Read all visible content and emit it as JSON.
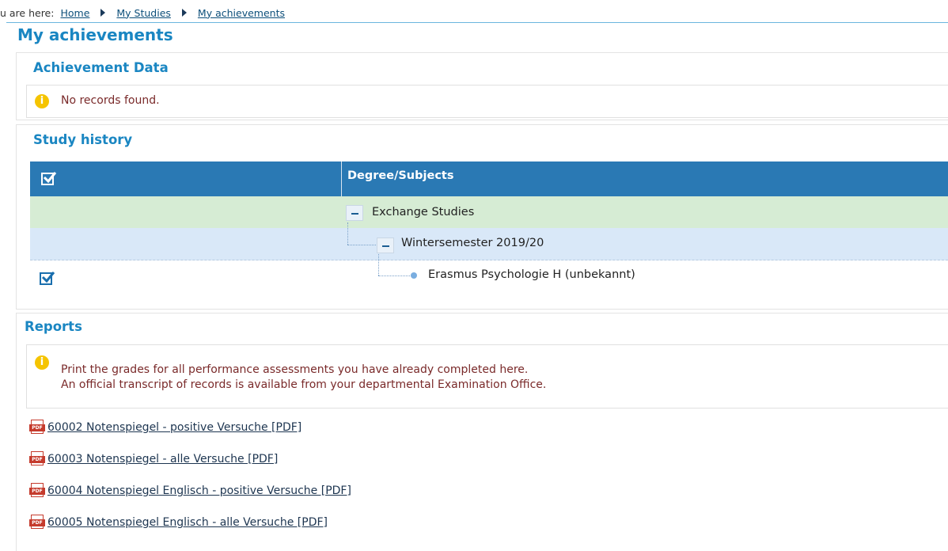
{
  "breadcrumb": {
    "prefix": "u are here:",
    "items": [
      "Home",
      "My Studies",
      "My achievements"
    ]
  },
  "page": {
    "title": "My achievements"
  },
  "achievement_data": {
    "title": "Achievement Data",
    "message": "No records found."
  },
  "study_history": {
    "title": "Study history",
    "column_header": "Degree/Subjects",
    "rows": [
      {
        "label": "Exchange Studies",
        "level": 0
      },
      {
        "label": "Wintersemester 2019/20",
        "level": 1
      },
      {
        "label": "Erasmus Psychologie H (unbekannt)",
        "level": 2,
        "checked": true
      }
    ]
  },
  "reports": {
    "title": "Reports",
    "info_line1": "Print the grades for all performance assessments you have already completed here.",
    "info_line2": "An official transcript of records is available from your departmental Examination Office.",
    "pdf_icon_text": "PDF",
    "links": [
      "60002 Notenspiegel - positive Versuche [PDF]",
      "60003 Notenspiegel - alle Versuche [PDF]",
      "60004 Notenspiegel Englisch - positive Versuche [PDF]",
      "60005 Notenspiegel Englisch - alle Versuche [PDF]"
    ]
  },
  "colors": {
    "accent": "#1a86c2",
    "header_bg": "#2a79b4",
    "row_green": "#d6ecd4",
    "row_blue": "#d9e8f8",
    "info_yellow": "#f5c400",
    "message_text": "#7a2a2a"
  },
  "icons": {
    "breadcrumb_separator": "triangle-right-icon",
    "info": "info-icon",
    "collapse": "minus-icon",
    "checkbox": "checkbox-checked-icon",
    "tree_leaf": "dot-icon",
    "pdf": "pdf-icon"
  }
}
